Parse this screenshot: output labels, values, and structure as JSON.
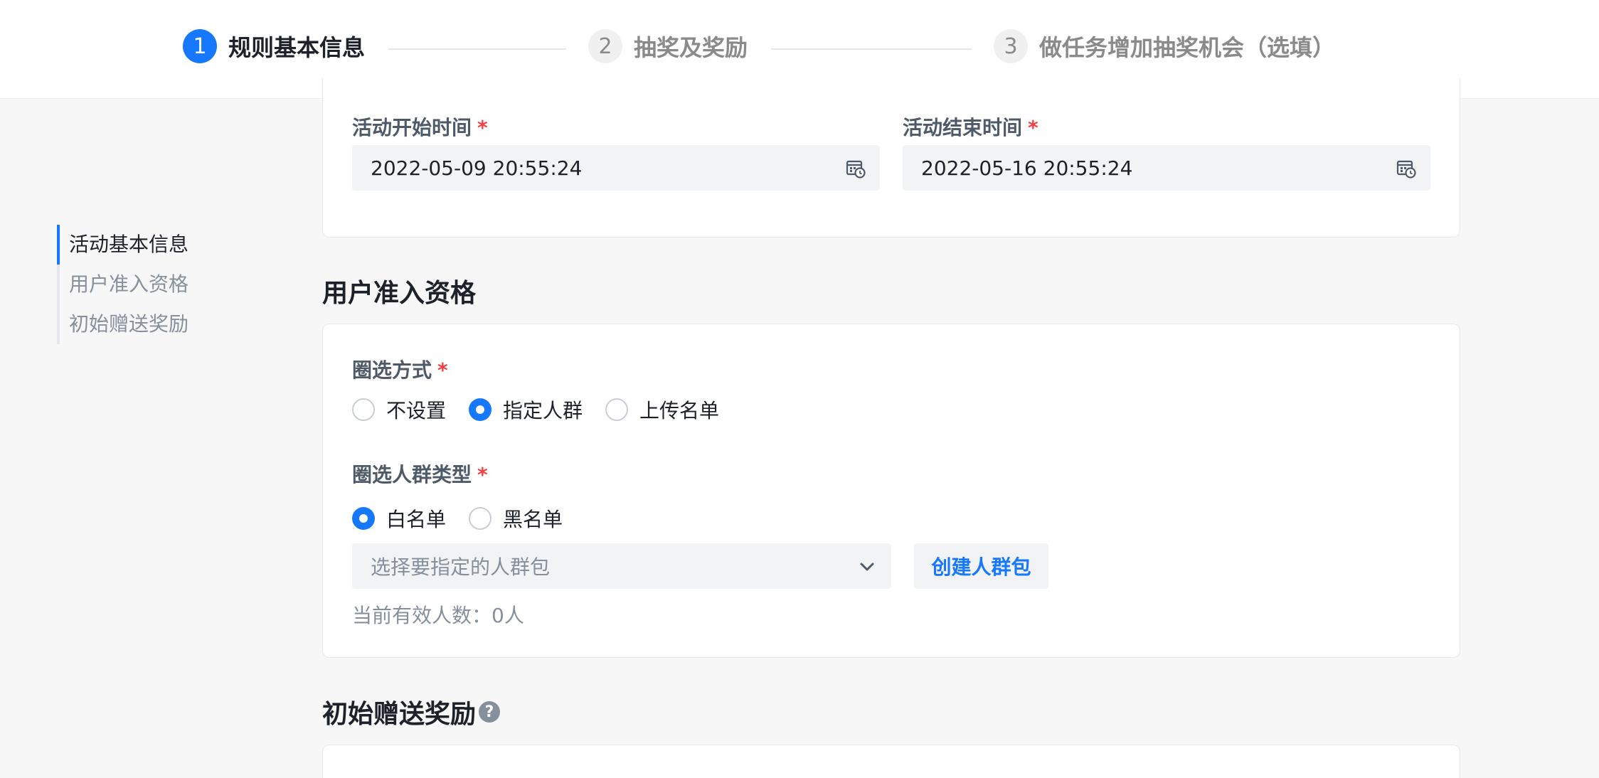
{
  "steps": [
    {
      "number": "1",
      "label": "规则基本信息",
      "state": "active"
    },
    {
      "number": "2",
      "label": "抽奖及奖励",
      "state": "inactive"
    },
    {
      "number": "3",
      "label": "做任务增加抽奖机会（选填）",
      "state": "inactive"
    }
  ],
  "anchor_nav": {
    "items": [
      {
        "label": "活动基本信息",
        "active": true
      },
      {
        "label": "用户准入资格",
        "active": false
      },
      {
        "label": "初始赠送奖励",
        "active": false
      }
    ]
  },
  "basic_info": {
    "start_time": {
      "label": "活动开始时间",
      "required_mark": "*",
      "value": "2022-05-09 20:55:24",
      "icon": "calendar-clock-icon"
    },
    "end_time": {
      "label": "活动结束时间",
      "required_mark": "*",
      "value": "2022-05-16 20:55:24",
      "icon": "calendar-clock-icon"
    }
  },
  "eligibility": {
    "title": "用户准入资格",
    "selection_method": {
      "label": "圈选方式",
      "required_mark": "*",
      "options": [
        {
          "label": "不设置",
          "checked": false
        },
        {
          "label": "指定人群",
          "checked": true
        },
        {
          "label": "上传名单",
          "checked": false
        }
      ]
    },
    "crowd_type": {
      "label": "圈选人群类型",
      "required_mark": "*",
      "options": [
        {
          "label": "白名单",
          "checked": true
        },
        {
          "label": "黑名单",
          "checked": false
        }
      ]
    },
    "crowd_select": {
      "placeholder": "选择要指定的人群包",
      "icon": "chevron-down-icon"
    },
    "create_button": "创建人群包",
    "valid_count": "当前有效人数：0人"
  },
  "initial_reward": {
    "title": "初始赠送奖励",
    "help_icon": "question-circle-icon",
    "help_glyph": "?"
  },
  "colors": {
    "primary": "#1677ff",
    "required": "#f53f3f"
  }
}
